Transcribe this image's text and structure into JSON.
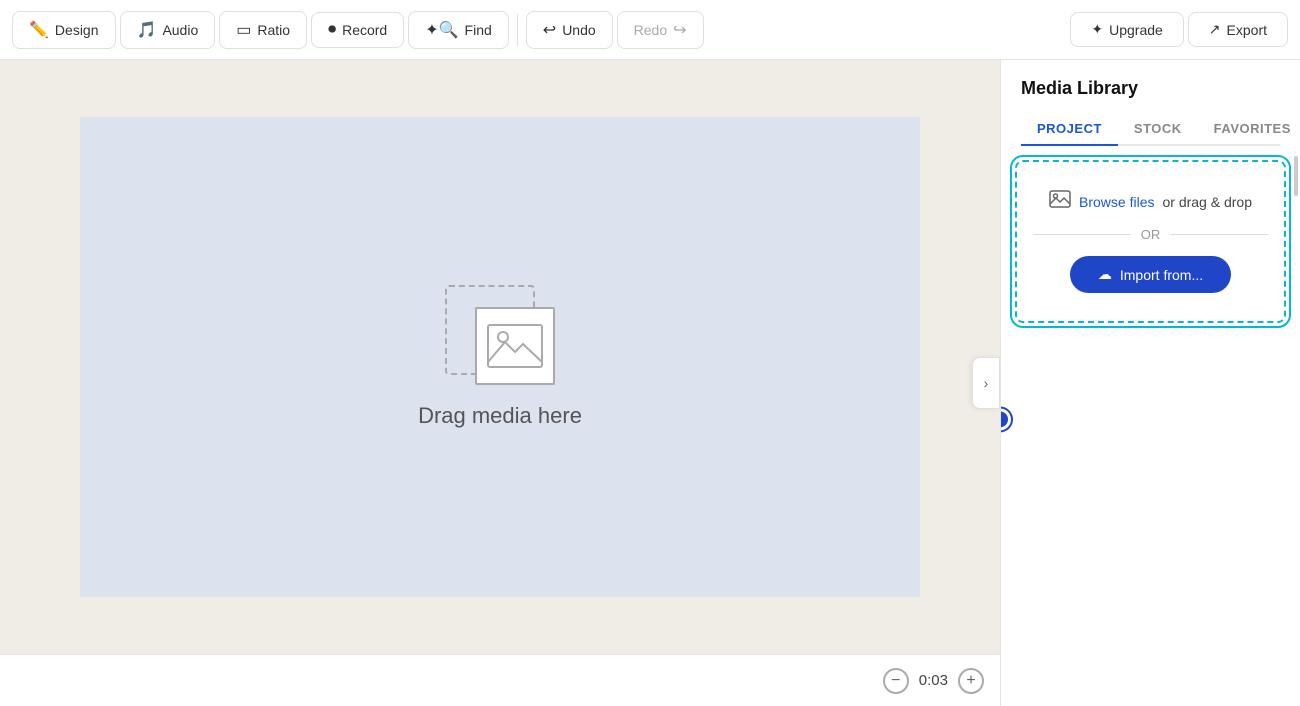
{
  "toolbar": {
    "design_label": "Design",
    "audio_label": "Audio",
    "ratio_label": "Ratio",
    "record_label": "Record",
    "find_label": "Find",
    "undo_label": "Undo",
    "redo_label": "Redo",
    "upgrade_label": "Upgrade",
    "export_label": "Export"
  },
  "canvas": {
    "drag_label": "Drag media here"
  },
  "timeline": {
    "time": "0:03",
    "minus_label": "−",
    "plus_label": "+"
  },
  "media_library": {
    "title": "Media Library",
    "tabs": [
      {
        "id": "project",
        "label": "PROJECT",
        "active": true
      },
      {
        "id": "stock",
        "label": "STOCK",
        "active": false
      },
      {
        "id": "favorites",
        "label": "FAVORITES",
        "active": false
      }
    ],
    "upload": {
      "browse_text": "Browse files",
      "or_text": "or drag & drop",
      "or_divider": "OR",
      "import_label": "Import from..."
    }
  },
  "collapse_btn": "›"
}
